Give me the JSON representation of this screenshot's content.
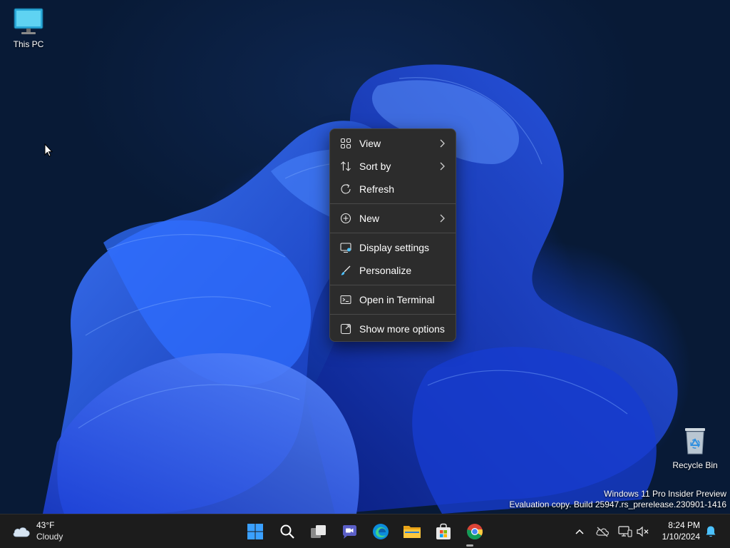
{
  "desktop": {
    "icons": [
      {
        "label": "This PC",
        "icon": "monitor-icon"
      },
      {
        "label": "Recycle Bin",
        "icon": "recycle-bin-icon"
      }
    ],
    "watermark": {
      "line1": "Windows 11 Pro Insider Preview",
      "line2": "Evaluation copy. Build 25947.rs_prerelease.230901-1416"
    }
  },
  "context_menu": {
    "items": [
      {
        "label": "View",
        "icon": "grid-icon",
        "submenu": true
      },
      {
        "label": "Sort by",
        "icon": "sort-icon",
        "submenu": true
      },
      {
        "label": "Refresh",
        "icon": "refresh-icon",
        "submenu": false
      },
      {
        "label": "New",
        "icon": "plus-circle-icon",
        "submenu": true
      },
      {
        "label": "Display settings",
        "icon": "display-icon",
        "submenu": false
      },
      {
        "label": "Personalize",
        "icon": "brush-icon",
        "submenu": false
      },
      {
        "label": "Open in Terminal",
        "icon": "terminal-icon",
        "submenu": false
      },
      {
        "label": "Show more options",
        "icon": "expand-icon",
        "submenu": false
      }
    ]
  },
  "taskbar": {
    "weather": {
      "temp": "43°F",
      "condition": "Cloudy",
      "icon": "cloud-icon"
    },
    "apps": [
      "start-icon",
      "search-icon",
      "task-view-icon",
      "meet-icon",
      "edge-icon",
      "file-explorer-icon",
      "store-icon",
      "chrome-icon"
    ],
    "tray": [
      "chevron-up-icon",
      "onedrive-icon",
      "network-icon",
      "volume-muted-icon"
    ],
    "clock": {
      "time": "8:24 PM",
      "date": "1/10/2024"
    }
  },
  "colors": {
    "menu_bg": "#2c2c2c",
    "taskbar_bg": "#1c1c1c",
    "accent": "#0078d4"
  }
}
